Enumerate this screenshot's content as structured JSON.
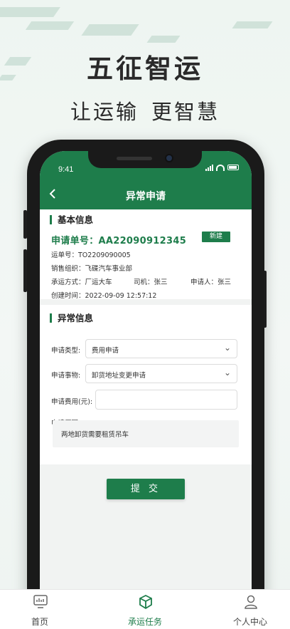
{
  "hero": {
    "title": "五征智运",
    "subtitle_left": "让运输",
    "subtitle_right": "更智慧"
  },
  "status_bar": {
    "time": "9:41"
  },
  "nav": {
    "title": "异常申请",
    "back_icon": "chevron-left-icon"
  },
  "basic_info": {
    "section_title": "基本信息",
    "order_label": "申请单号：",
    "order_no": "AA22090912345",
    "status_badge": "新建",
    "waybill": "运单号：TO2209090005",
    "sales_org": "销售组织：飞碟汽车事业部",
    "transport_mode": "承运方式：厂运大车",
    "driver": "司机：张三",
    "applicant": "申请人：张三",
    "created_at": "创建时间：2022-09-09  12:57:12"
  },
  "exception_info": {
    "section_title": "异常信息",
    "type_label": "申请类型:",
    "type_value": "费用申请",
    "matter_label": "申请事物:",
    "matter_value": "卸货地址变更申请",
    "fee_label": "申请费用(元):",
    "fee_value": "",
    "reason_label": "申请原因:",
    "reason_value": "两地卸货需要租赁吊车"
  },
  "submit_label": "提 交",
  "tabs": [
    {
      "label": "首页",
      "icon": "monitor-icon",
      "active": false
    },
    {
      "label": "承运任务",
      "icon": "box-icon",
      "active": true
    },
    {
      "label": "个人中心",
      "icon": "user-icon",
      "active": false
    }
  ],
  "colors": {
    "primary": "#1e7d4b",
    "page_bg": "#f1f3f2",
    "text": "#333333"
  }
}
